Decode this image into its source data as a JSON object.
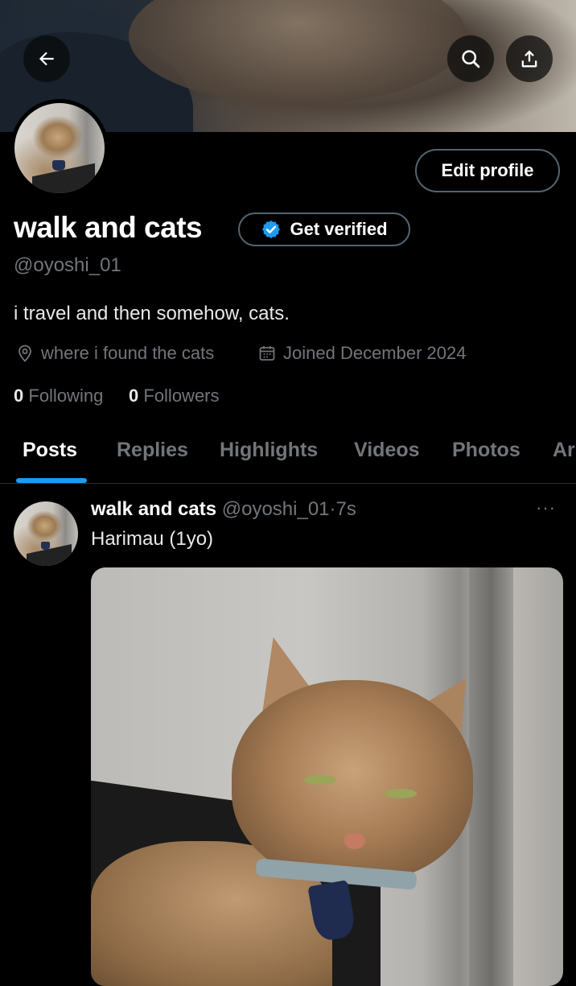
{
  "header": {
    "back_icon": "arrow-left-icon",
    "search_icon": "search-icon",
    "share_icon": "share-icon"
  },
  "profile": {
    "display_name": "walk and cats",
    "get_verified_label": "Get verified",
    "handle": "@oyoshi_01",
    "bio": "i travel and then somehow, cats.",
    "location": "where i found the cats",
    "joined": "Joined December 2024",
    "following_count": "0",
    "following_label": "Following",
    "followers_count": "0",
    "followers_label": "Followers",
    "edit_profile_label": "Edit profile"
  },
  "tabs": [
    {
      "label": "Posts",
      "active": true
    },
    {
      "label": "Replies",
      "active": false
    },
    {
      "label": "Highlights",
      "active": false
    },
    {
      "label": "Videos",
      "active": false
    },
    {
      "label": "Photos",
      "active": false
    },
    {
      "label": "Ar",
      "active": false
    }
  ],
  "post": {
    "author_name": "walk and cats",
    "author_handle": "@oyoshi_01",
    "separator": "·",
    "time": "7s",
    "more": "···",
    "text": "Harimau (1yo)"
  },
  "colors": {
    "background": "#000000",
    "accent": "#1d9bf0",
    "secondary_text": "#71767b",
    "border": "#536471"
  }
}
